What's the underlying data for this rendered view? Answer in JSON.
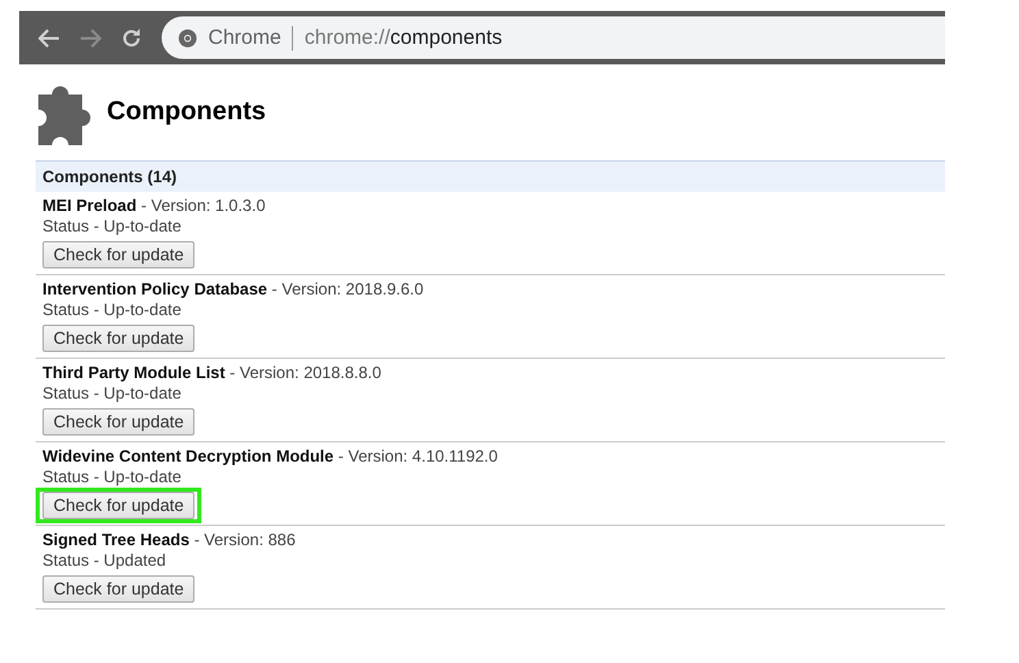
{
  "toolbar": {
    "site_label": "Chrome",
    "url_scheme": "chrome://",
    "url_path": "components"
  },
  "page": {
    "title": "Components"
  },
  "table": {
    "header": "Components (14)",
    "rows": [
      {
        "name": "MEI Preload",
        "version": "- Version: 1.0.3.0",
        "status": "Status - Up-to-date",
        "button": "Check for update",
        "highlighted": false
      },
      {
        "name": "Intervention Policy Database",
        "version": "- Version: 2018.9.6.0",
        "status": "Status - Up-to-date",
        "button": "Check for update",
        "highlighted": false
      },
      {
        "name": "Third Party Module List",
        "version": "- Version: 2018.8.8.0",
        "status": "Status - Up-to-date",
        "button": "Check for update",
        "highlighted": false
      },
      {
        "name": "Widevine Content Decryption Module",
        "version": "- Version: 4.10.1192.0",
        "status": "Status - Up-to-date",
        "button": "Check for update",
        "highlighted": true
      },
      {
        "name": "Signed Tree Heads",
        "version": "- Version: 886",
        "status": "Status - Updated",
        "button": "Check for update",
        "highlighted": false
      }
    ]
  }
}
